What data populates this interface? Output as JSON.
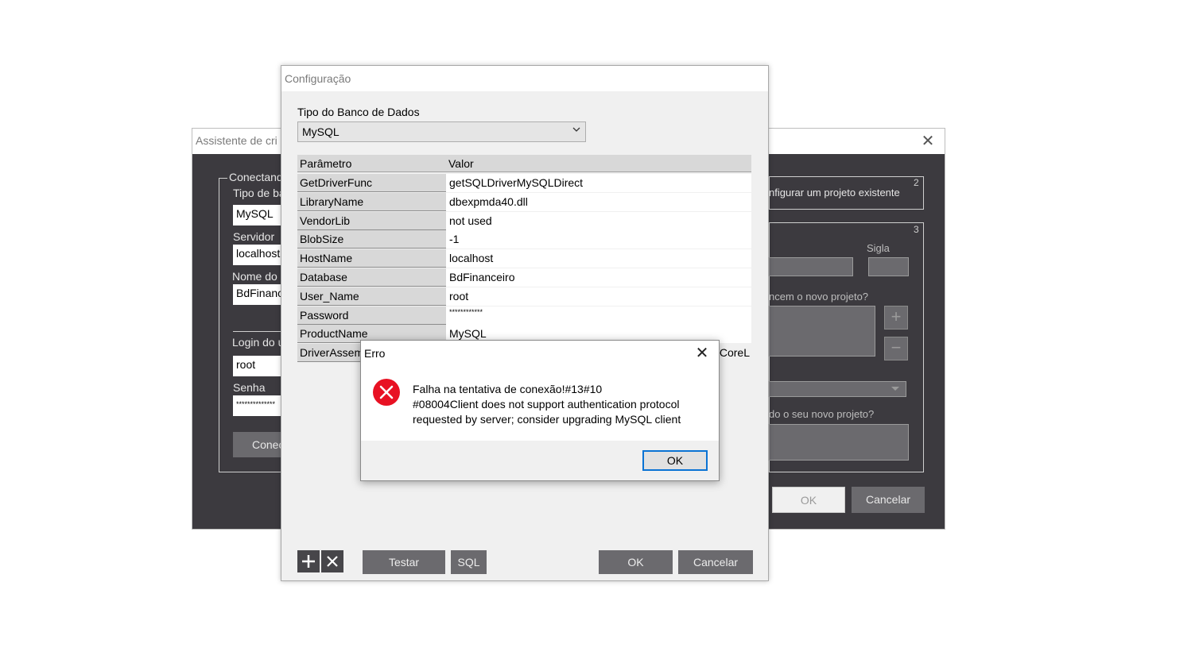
{
  "wizard": {
    "title": "Assistente de cri",
    "close_glyph": "✕",
    "connecting_label": "Conectand",
    "db_type_label": "Tipo de ba",
    "db_type_value": "MySQL",
    "server_label": "Servidor",
    "server_value": "localhost:",
    "dbname_label": "Nome do b",
    "dbname_value": "BdFinanc",
    "login_label": "Login do u",
    "login_value": "root",
    "password_label": "Senha",
    "password_value": "**************",
    "connect_button": "Conec",
    "configure_existing": "nfigurar um projeto existente",
    "group2_number": "2",
    "group3_number": "3",
    "sigla_label": "Sigla",
    "new_project_question": "ncem o novo projeto?",
    "new_project_question2": "do o seu novo projeto?",
    "plus_glyph": "+",
    "minus_glyph": "−",
    "ok_button": "OK",
    "cancel_button": "Cancelar"
  },
  "config": {
    "title": "Configuração",
    "db_type_label": "Tipo do Banco de Dados",
    "db_type_value": "MySQL",
    "grid": {
      "header_param": "Parâmetro",
      "header_value": "Valor",
      "rows": [
        {
          "param": "GetDriverFunc",
          "value": "getSQLDriverMySQLDirect"
        },
        {
          "param": "LibraryName",
          "value": "dbexpmda40.dll"
        },
        {
          "param": "VendorLib",
          "value": "not used"
        },
        {
          "param": "BlobSize",
          "value": "-1"
        },
        {
          "param": "HostName",
          "value": "localhost"
        },
        {
          "param": "Database",
          "value": "BdFinanceiro"
        },
        {
          "param": "User_Name",
          "value": "root"
        },
        {
          "param": "Password",
          "value": "************"
        },
        {
          "param": "ProductName",
          "value": "MySQL"
        },
        {
          "param": "DriverAssembl",
          "value": ",CoreL"
        }
      ]
    },
    "add_glyph": "+",
    "remove_glyph": "✕",
    "test_button": "Testar",
    "sql_button": "SQL",
    "ok_button": "OK",
    "cancel_button": "Cancelar"
  },
  "error_dialog": {
    "title": "Erro",
    "close_glyph": "✕",
    "message_line1": "Falha na tentativa de conexão!#13#10",
    "message_line2": "#08004Client does not support authentication protocol",
    "message_line3": "requested by server; consider upgrading MySQL client",
    "ok_button": "OK",
    "icon": "error-icon",
    "icon_color": "#e81123"
  }
}
